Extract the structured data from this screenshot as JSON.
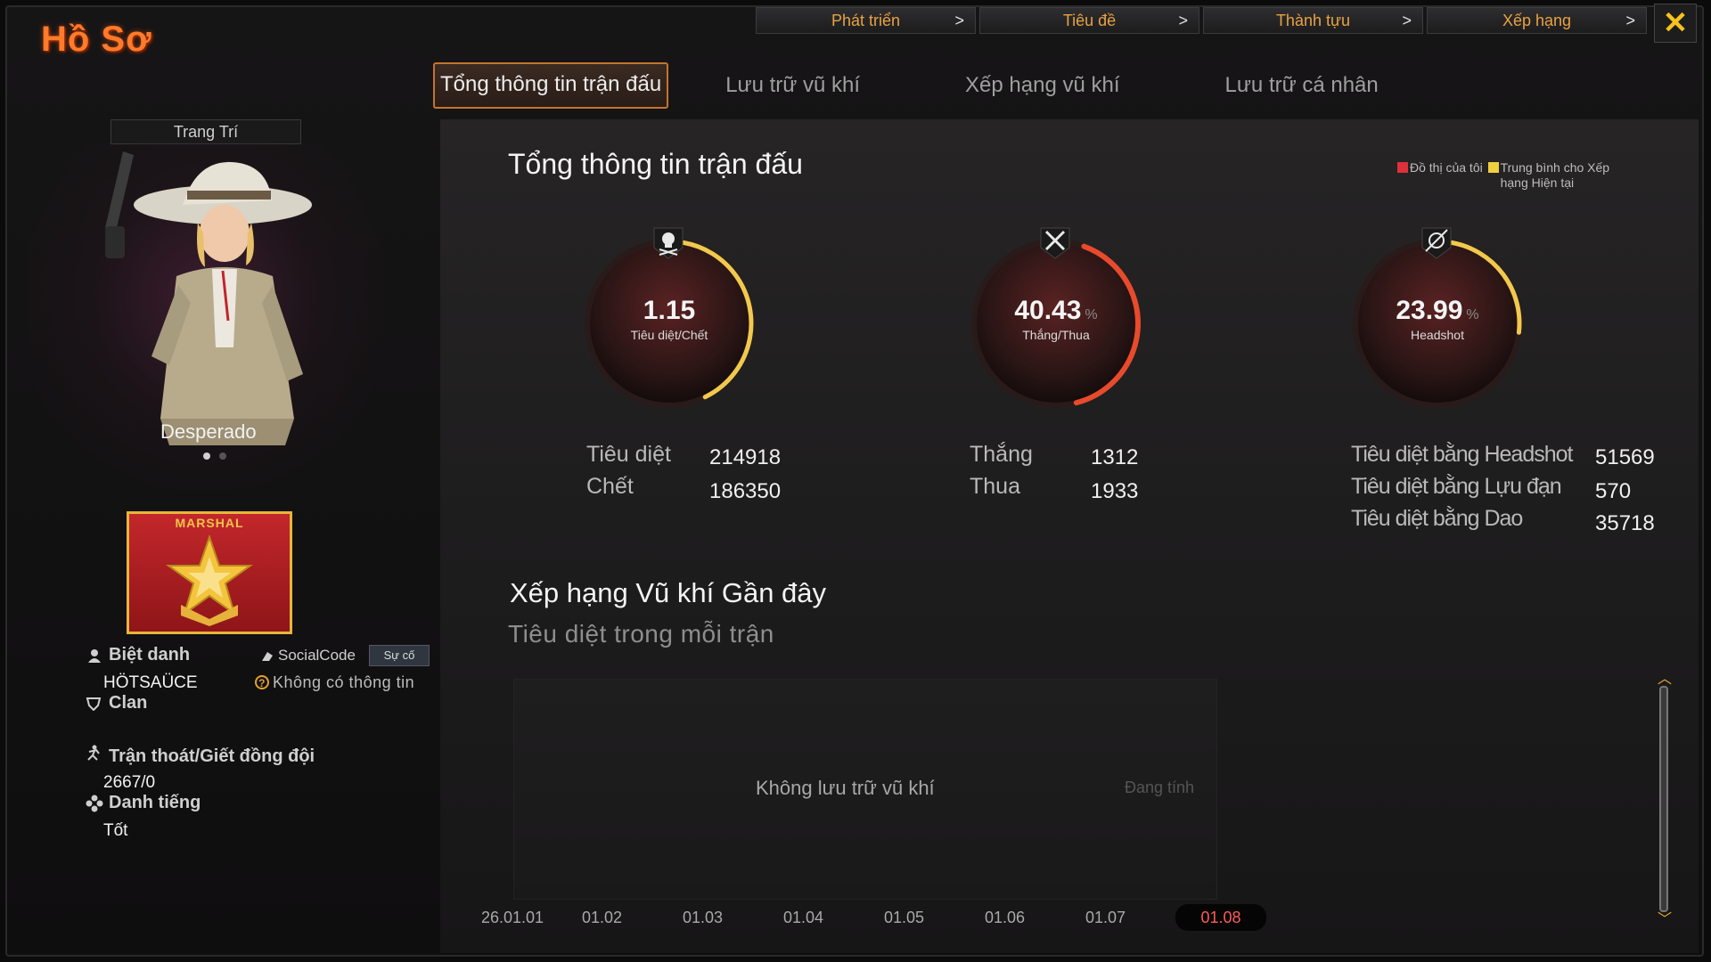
{
  "title": "Hồ Sơ",
  "top_nav": [
    {
      "label": "Phát triển"
    },
    {
      "label": "Tiêu đề"
    },
    {
      "label": "Thành tựu"
    },
    {
      "label": "Xếp hạng"
    }
  ],
  "close_label": "✕",
  "tabs": [
    {
      "label": "Tổng thông tin trận đấu",
      "active": true
    },
    {
      "label": "Lưu trữ vũ khí"
    },
    {
      "label": "Xếp hạng vũ khí"
    },
    {
      "label": "Lưu trữ cá nhân"
    }
  ],
  "character": {
    "decor_button": "Trang Trí",
    "name": "Desperado",
    "rank_label": "MARSHAL"
  },
  "profile": {
    "nickname_label": "Biệt danh",
    "nickname_value": "HÖTSAÜCE",
    "socialcode_label": "SocialCode",
    "socialcode_button": "Sự cố",
    "socialcode_value": "Không có thông tin",
    "clan_label": "Clan",
    "escape_label": "Trận thoát/Giết đồng đội",
    "escape_value": "2667/0",
    "reputation_label": "Danh tiếng",
    "reputation_value": "Tốt"
  },
  "main": {
    "heading": "Tổng thông tin trận đấu",
    "legend_mine": "Đồ thị của tôi",
    "legend_avg": "Trung bình cho Xếp hạng Hiện tại",
    "gauges": [
      {
        "value": "1.15",
        "unit": "",
        "label": "Tiêu diệt/Chết",
        "fill": 0.4,
        "icon": "skull-icon"
      },
      {
        "value": "40.43",
        "unit": "%",
        "label": "Thắng/Thua",
        "fill": 0.4043,
        "icon": "crossed-swords-icon"
      },
      {
        "value": "23.99",
        "unit": "%",
        "label": "Headshot",
        "fill": 0.2399,
        "icon": "headshot-icon"
      }
    ],
    "kd": {
      "kills_label": "Tiêu diệt",
      "kills": "214918",
      "deaths_label": "Chết",
      "deaths": "186350"
    },
    "wl": {
      "wins_label": "Thắng",
      "wins": "1312",
      "losses_label": "Thua",
      "losses": "1933"
    },
    "hs": {
      "headshot_label": "Tiêu diệt bằng Headshot",
      "headshot": "51569",
      "grenade_label": "Tiêu diệt bằng Lựu đạn",
      "grenade": "570",
      "knife_label": "Tiêu diệt bằng Dao",
      "knife": "35718"
    },
    "recent_heading": "Xếp hạng Vũ khí Gần đây",
    "recent_subheading": "Tiêu diệt trong mỗi trận",
    "empty_text": "Không lưu trữ vũ khí",
    "calc_text": "Đang tính",
    "dates": [
      "26.01.01",
      "01.02",
      "01.03",
      "01.04",
      "01.05",
      "01.06",
      "01.07",
      "01.08"
    ],
    "active_date": "01.08"
  },
  "colors": {
    "accent_orange": "#ff7a2a",
    "legend_red": "#e0313a",
    "legend_yellow": "#f0d040",
    "active_date": "#ff5a56"
  }
}
